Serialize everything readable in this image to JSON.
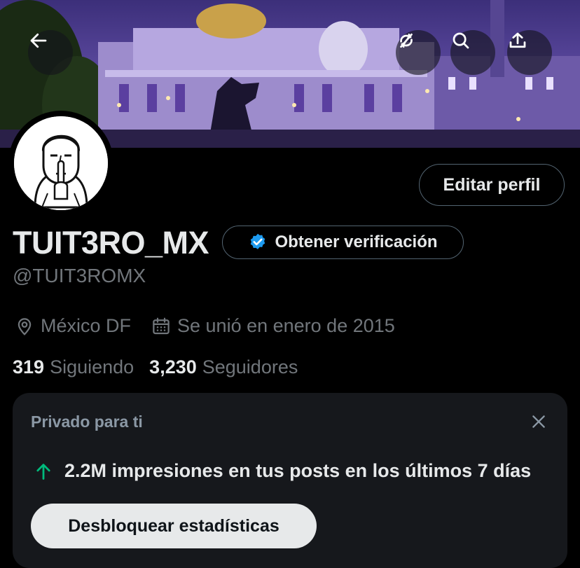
{
  "banner": {
    "back_icon": "arrow-left-icon",
    "action_icons": [
      "refresh-slash-icon",
      "search-icon",
      "share-upload-icon"
    ]
  },
  "profile": {
    "display_name": "TUIT3RO_MX",
    "handle": "@TUIT3ROMX",
    "edit_label": "Editar perfil",
    "verify_label": "Obtener verificación",
    "location": "México DF",
    "joined": "Se unió en enero de 2015",
    "following_count": "319",
    "following_label": "Siguiendo",
    "followers_count": "3,230",
    "followers_label": "Seguidores"
  },
  "insight_card": {
    "label": "Privado para ti",
    "stat_text": "2.2M impresiones en tus posts en los últimos 7 días",
    "unlock_label": "Desbloquear estadísticas"
  },
  "colors": {
    "background": "#000000",
    "verified_blue": "#1d9bf0",
    "trend_green": "#00ba7c",
    "muted_text": "#71767b"
  }
}
